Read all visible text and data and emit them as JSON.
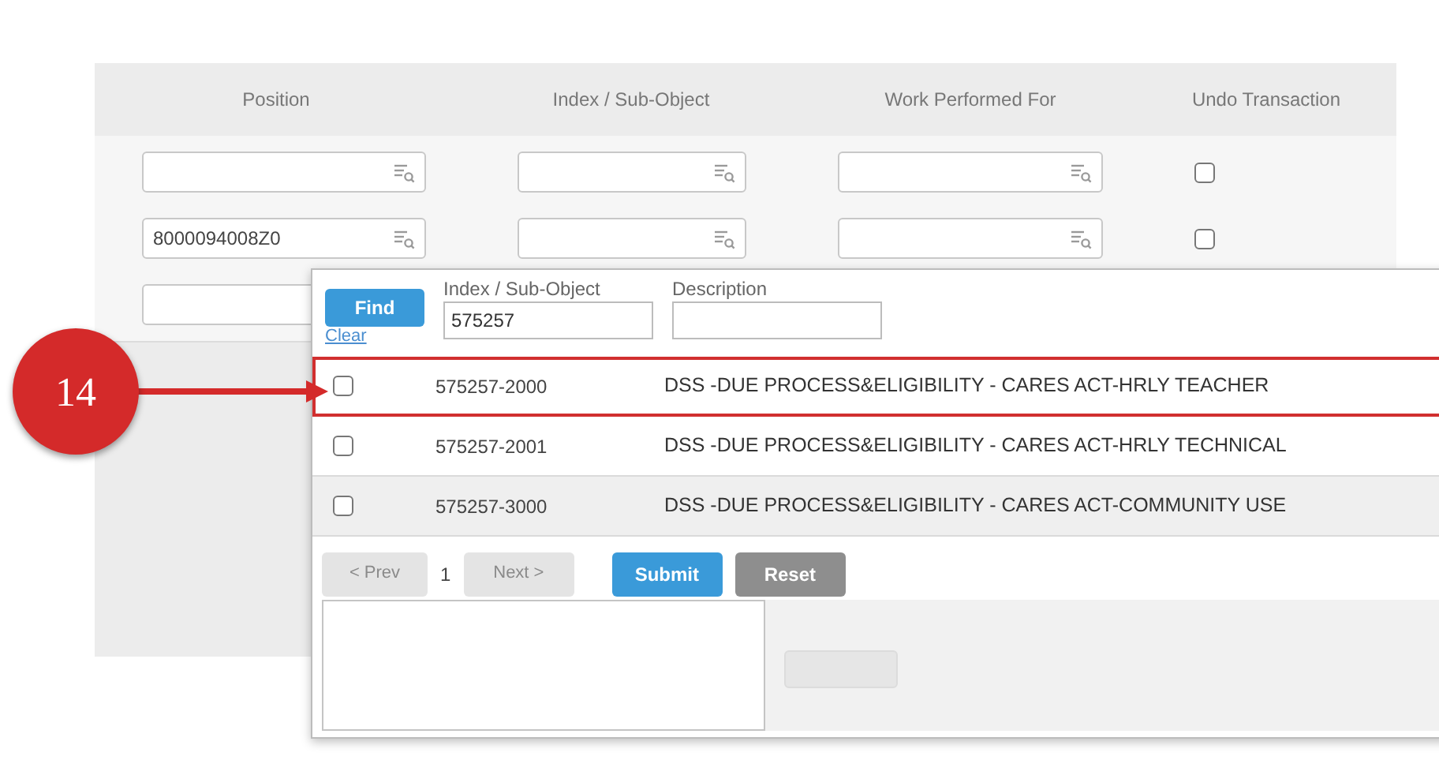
{
  "table": {
    "columns": [
      "Position",
      "Index / Sub-Object",
      "Work Performed For",
      "Undo Transaction"
    ],
    "rows": [
      {
        "position": "",
        "index": "",
        "work_for": "",
        "undo": false
      },
      {
        "position": "8000094008Z0",
        "index": "",
        "work_for": "",
        "undo": false
      },
      {
        "position": ""
      }
    ]
  },
  "lookup": {
    "find_button": "Find",
    "clear_link": "Clear",
    "filters": [
      {
        "label": "Index / Sub-Object",
        "value": "575257"
      },
      {
        "label": "Description"
      }
    ],
    "results": [
      {
        "checked": false,
        "highlighted": true,
        "code": "575257-2000",
        "description": "DSS -DUE PROCESS&ELIGIBILITY - CARES ACT-HRLY TEACHER"
      },
      {
        "checked": false,
        "highlighted": false,
        "code": "575257-2001",
        "description": "DSS -DUE PROCESS&ELIGIBILITY - CARES ACT-HRLY TECHNICAL"
      },
      {
        "checked": false,
        "highlighted": false,
        "code": "575257-3000",
        "description": "DSS -DUE PROCESS&ELIGIBILITY - CARES ACT-COMMUNITY USE"
      }
    ],
    "pager": {
      "prev": "< Prev",
      "page": "1",
      "next": "Next >",
      "prev_disabled": true,
      "next_disabled": true
    },
    "submit_button": "Submit",
    "reset_button": "Reset"
  },
  "callout": {
    "number": "14"
  }
}
